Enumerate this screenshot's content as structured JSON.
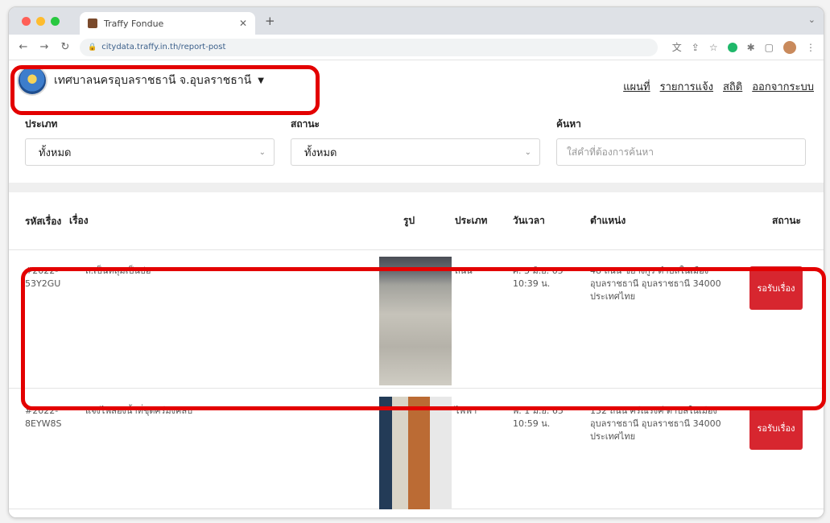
{
  "browser": {
    "tab_title": "Traffy Fondue",
    "url": "citydata.traffy.in.th/report-post"
  },
  "header": {
    "org_name": "เทศบาลนครอุบลราชธานี จ.อุบลราชธานี",
    "nav": [
      "แผนที่",
      "รายการแจ้ง",
      "สถิติ",
      "ออกจากระบบ"
    ]
  },
  "filters": {
    "type_label": "ประเภท",
    "type_value": "ทั้งหมด",
    "status_label": "สถานะ",
    "status_value": "ทั้งหมด",
    "search_label": "ค้นหา",
    "search_placeholder": "ใส่คำที่ต้องการค้นหา"
  },
  "table": {
    "headers": {
      "id": "รหัสเรื่อง",
      "title": "เรื่อง",
      "image": "รูป",
      "type": "ประเภท",
      "date": "วันเวลา",
      "location": "ตำแหน่ง",
      "status": "สถานะ"
    },
    "rows": [
      {
        "id": "#2022-53Y2GU",
        "title": "ถ.เป็นหลุมเป็นบ่อ",
        "type": "ถนน",
        "date": "ศ. 3 มิ.ย. 65 10:39 น.",
        "location": "48 ถนน ชยางกูร ตำบลในเมือง อุบลราชธานี อุบลราชธานี 34000 ประเทศไทย",
        "status": "รอรับเรื่อง"
      },
      {
        "id": "#2022-8EYW8S",
        "title": "แจ้งไฟส่องน้ำที่ชุดศรีมังคลับ",
        "type": "ไฟฟ้า",
        "date": "พ. 1 มิ.ย. 65 10:59 น.",
        "location": "132 ถนน ศรีณรงค์ ตำบลในเมือง อุบลราชธานี อุบลราชธานี 34000 ประเทศไทย",
        "status": "รอรับเรื่อง"
      }
    ]
  },
  "colors": {
    "status_badge": "#d7262f",
    "highlight": "#e30000"
  }
}
